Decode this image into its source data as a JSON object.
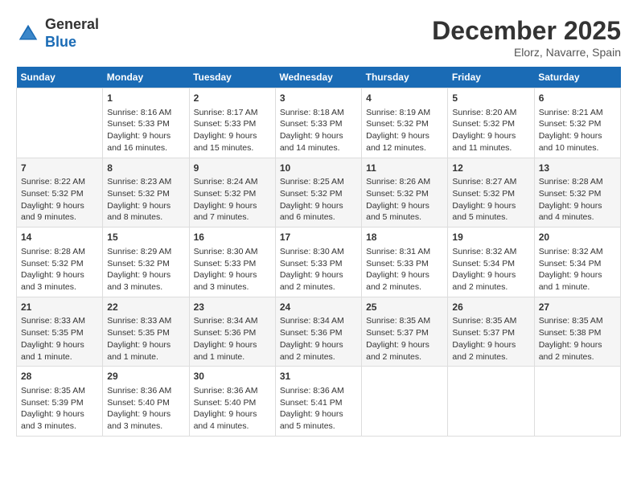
{
  "header": {
    "logo_general": "General",
    "logo_blue": "Blue",
    "title": "December 2025",
    "subtitle": "Elorz, Navarre, Spain"
  },
  "days_of_week": [
    "Sunday",
    "Monday",
    "Tuesday",
    "Wednesday",
    "Thursday",
    "Friday",
    "Saturday"
  ],
  "weeks": [
    [
      {
        "num": "",
        "info": ""
      },
      {
        "num": "1",
        "info": "Sunrise: 8:16 AM\nSunset: 5:33 PM\nDaylight: 9 hours\nand 16 minutes."
      },
      {
        "num": "2",
        "info": "Sunrise: 8:17 AM\nSunset: 5:33 PM\nDaylight: 9 hours\nand 15 minutes."
      },
      {
        "num": "3",
        "info": "Sunrise: 8:18 AM\nSunset: 5:33 PM\nDaylight: 9 hours\nand 14 minutes."
      },
      {
        "num": "4",
        "info": "Sunrise: 8:19 AM\nSunset: 5:32 PM\nDaylight: 9 hours\nand 12 minutes."
      },
      {
        "num": "5",
        "info": "Sunrise: 8:20 AM\nSunset: 5:32 PM\nDaylight: 9 hours\nand 11 minutes."
      },
      {
        "num": "6",
        "info": "Sunrise: 8:21 AM\nSunset: 5:32 PM\nDaylight: 9 hours\nand 10 minutes."
      }
    ],
    [
      {
        "num": "7",
        "info": "Sunrise: 8:22 AM\nSunset: 5:32 PM\nDaylight: 9 hours\nand 9 minutes."
      },
      {
        "num": "8",
        "info": "Sunrise: 8:23 AM\nSunset: 5:32 PM\nDaylight: 9 hours\nand 8 minutes."
      },
      {
        "num": "9",
        "info": "Sunrise: 8:24 AM\nSunset: 5:32 PM\nDaylight: 9 hours\nand 7 minutes."
      },
      {
        "num": "10",
        "info": "Sunrise: 8:25 AM\nSunset: 5:32 PM\nDaylight: 9 hours\nand 6 minutes."
      },
      {
        "num": "11",
        "info": "Sunrise: 8:26 AM\nSunset: 5:32 PM\nDaylight: 9 hours\nand 5 minutes."
      },
      {
        "num": "12",
        "info": "Sunrise: 8:27 AM\nSunset: 5:32 PM\nDaylight: 9 hours\nand 5 minutes."
      },
      {
        "num": "13",
        "info": "Sunrise: 8:28 AM\nSunset: 5:32 PM\nDaylight: 9 hours\nand 4 minutes."
      }
    ],
    [
      {
        "num": "14",
        "info": "Sunrise: 8:28 AM\nSunset: 5:32 PM\nDaylight: 9 hours\nand 3 minutes."
      },
      {
        "num": "15",
        "info": "Sunrise: 8:29 AM\nSunset: 5:32 PM\nDaylight: 9 hours\nand 3 minutes."
      },
      {
        "num": "16",
        "info": "Sunrise: 8:30 AM\nSunset: 5:33 PM\nDaylight: 9 hours\nand 3 minutes."
      },
      {
        "num": "17",
        "info": "Sunrise: 8:30 AM\nSunset: 5:33 PM\nDaylight: 9 hours\nand 2 minutes."
      },
      {
        "num": "18",
        "info": "Sunrise: 8:31 AM\nSunset: 5:33 PM\nDaylight: 9 hours\nand 2 minutes."
      },
      {
        "num": "19",
        "info": "Sunrise: 8:32 AM\nSunset: 5:34 PM\nDaylight: 9 hours\nand 2 minutes."
      },
      {
        "num": "20",
        "info": "Sunrise: 8:32 AM\nSunset: 5:34 PM\nDaylight: 9 hours\nand 1 minute."
      }
    ],
    [
      {
        "num": "21",
        "info": "Sunrise: 8:33 AM\nSunset: 5:35 PM\nDaylight: 9 hours\nand 1 minute."
      },
      {
        "num": "22",
        "info": "Sunrise: 8:33 AM\nSunset: 5:35 PM\nDaylight: 9 hours\nand 1 minute."
      },
      {
        "num": "23",
        "info": "Sunrise: 8:34 AM\nSunset: 5:36 PM\nDaylight: 9 hours\nand 1 minute."
      },
      {
        "num": "24",
        "info": "Sunrise: 8:34 AM\nSunset: 5:36 PM\nDaylight: 9 hours\nand 2 minutes."
      },
      {
        "num": "25",
        "info": "Sunrise: 8:35 AM\nSunset: 5:37 PM\nDaylight: 9 hours\nand 2 minutes."
      },
      {
        "num": "26",
        "info": "Sunrise: 8:35 AM\nSunset: 5:37 PM\nDaylight: 9 hours\nand 2 minutes."
      },
      {
        "num": "27",
        "info": "Sunrise: 8:35 AM\nSunset: 5:38 PM\nDaylight: 9 hours\nand 2 minutes."
      }
    ],
    [
      {
        "num": "28",
        "info": "Sunrise: 8:35 AM\nSunset: 5:39 PM\nDaylight: 9 hours\nand 3 minutes."
      },
      {
        "num": "29",
        "info": "Sunrise: 8:36 AM\nSunset: 5:40 PM\nDaylight: 9 hours\nand 3 minutes."
      },
      {
        "num": "30",
        "info": "Sunrise: 8:36 AM\nSunset: 5:40 PM\nDaylight: 9 hours\nand 4 minutes."
      },
      {
        "num": "31",
        "info": "Sunrise: 8:36 AM\nSunset: 5:41 PM\nDaylight: 9 hours\nand 5 minutes."
      },
      {
        "num": "",
        "info": ""
      },
      {
        "num": "",
        "info": ""
      },
      {
        "num": "",
        "info": ""
      }
    ]
  ]
}
